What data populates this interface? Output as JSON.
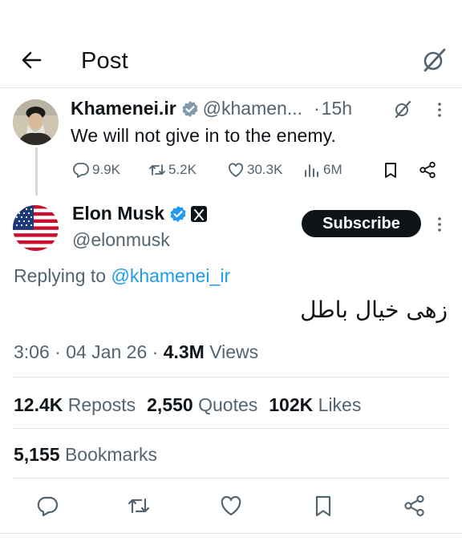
{
  "header": {
    "title": "Post",
    "back_icon": "arrow-left-icon",
    "grok_icon": "grok-icon"
  },
  "parent_post": {
    "name": "Khamenei.ir",
    "handle": "@khamen...",
    "dot": "·",
    "time": "15h",
    "text": "We will not give in to the enemy.",
    "replies": "9.9K",
    "reposts": "5.2K",
    "likes": "30.3K",
    "views": "6M"
  },
  "main_post": {
    "name": "Elon Musk",
    "handle": "@elonmusk",
    "subscribe_label": "Subscribe",
    "replying_prefix": "Replying to ",
    "replying_to": "@khamenei_ir",
    "text": "زهی خیال باطل",
    "time": "3:06 · 04 Jan 26 · ",
    "views_count": "4.3M",
    "views_label": " Views"
  },
  "stats": {
    "reposts_count": "12.4K",
    "reposts_label": "Reposts",
    "quotes_count": "2,550",
    "quotes_label": "Quotes",
    "likes_count": "102K",
    "likes_label": "Likes",
    "bookmarks_count": "5,155",
    "bookmarks_label": "Bookmarks"
  },
  "colors": {
    "verified": "#1d9bf0",
    "link": "#1d9bf0",
    "muted": "#536471",
    "text": "#0f1419"
  }
}
